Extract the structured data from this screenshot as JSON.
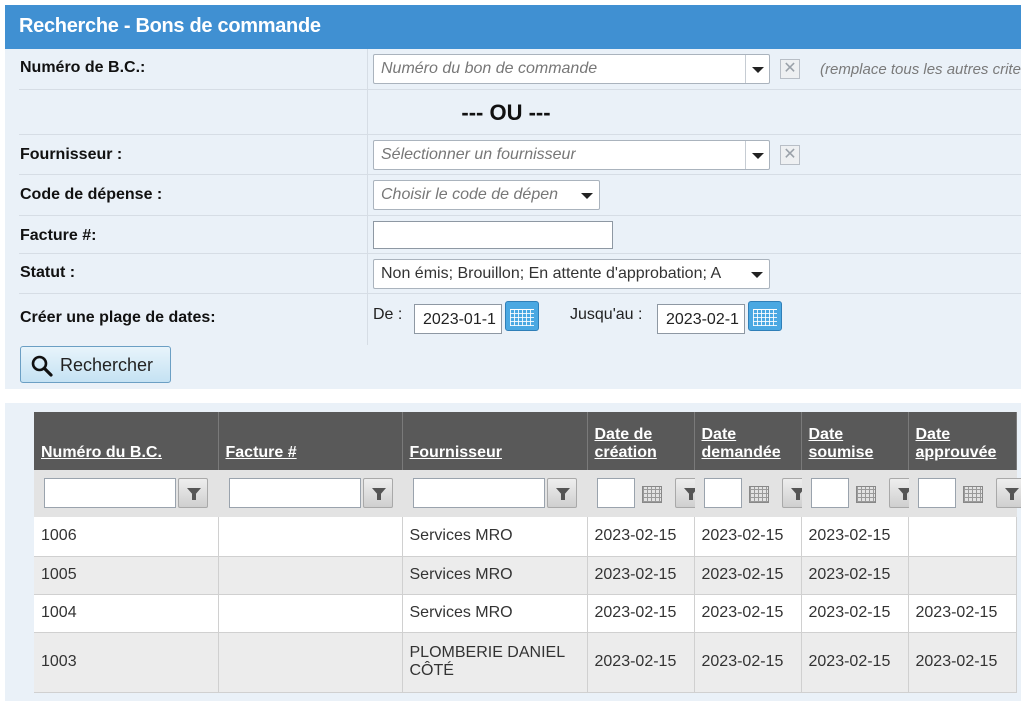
{
  "header": {
    "title": "Recherche - Bons de commande"
  },
  "form": {
    "po_number": {
      "label": "Numéro de B.C.:",
      "placeholder": "Numéro du bon de commande",
      "note": "(remplace tous les autres crite"
    },
    "or_separator": "--- OU ---",
    "supplier": {
      "label": "Fournisseur :",
      "placeholder": "Sélectionner un fournisseur"
    },
    "expense_code": {
      "label": "Code de dépense :",
      "placeholder": "Choisir le code de dépen"
    },
    "invoice": {
      "label": "Facture #:",
      "value": ""
    },
    "status": {
      "label": "Statut :",
      "value": "Non émis; Brouillon; En attente d'approbation; A"
    },
    "date_range": {
      "label": "Créer une plage de dates:",
      "from_label": "De :",
      "from_value": "2023-01-1",
      "to_label": "Jusqu'au :",
      "to_value": "2023-02-1"
    },
    "search_button": "Rechercher"
  },
  "grid": {
    "columns": [
      "Numéro du B.C.",
      "Facture #",
      "Fournisseur",
      "Date de création",
      "Date demandée",
      "Date soumise",
      "Date approuvée"
    ],
    "rows": [
      [
        "1006",
        "",
        "Services MRO",
        "2023-02-15",
        "2023-02-15",
        "2023-02-15",
        ""
      ],
      [
        "1005",
        "",
        "Services MRO",
        "2023-02-15",
        "2023-02-15",
        "2023-02-15",
        ""
      ],
      [
        "1004",
        "",
        "Services MRO",
        "2023-02-15",
        "2023-02-15",
        "2023-02-15",
        "2023-02-15"
      ],
      [
        "1003",
        "",
        "PLOMBERIE DANIEL CÔTÉ",
        "2023-02-15",
        "2023-02-15",
        "2023-02-15",
        "2023-02-15"
      ]
    ]
  },
  "colors": {
    "header_bg": "#4090d2",
    "panel_bg": "#eaf1f8",
    "grid_header_bg": "#595959",
    "calendar_blue": "#4aa8e2"
  }
}
